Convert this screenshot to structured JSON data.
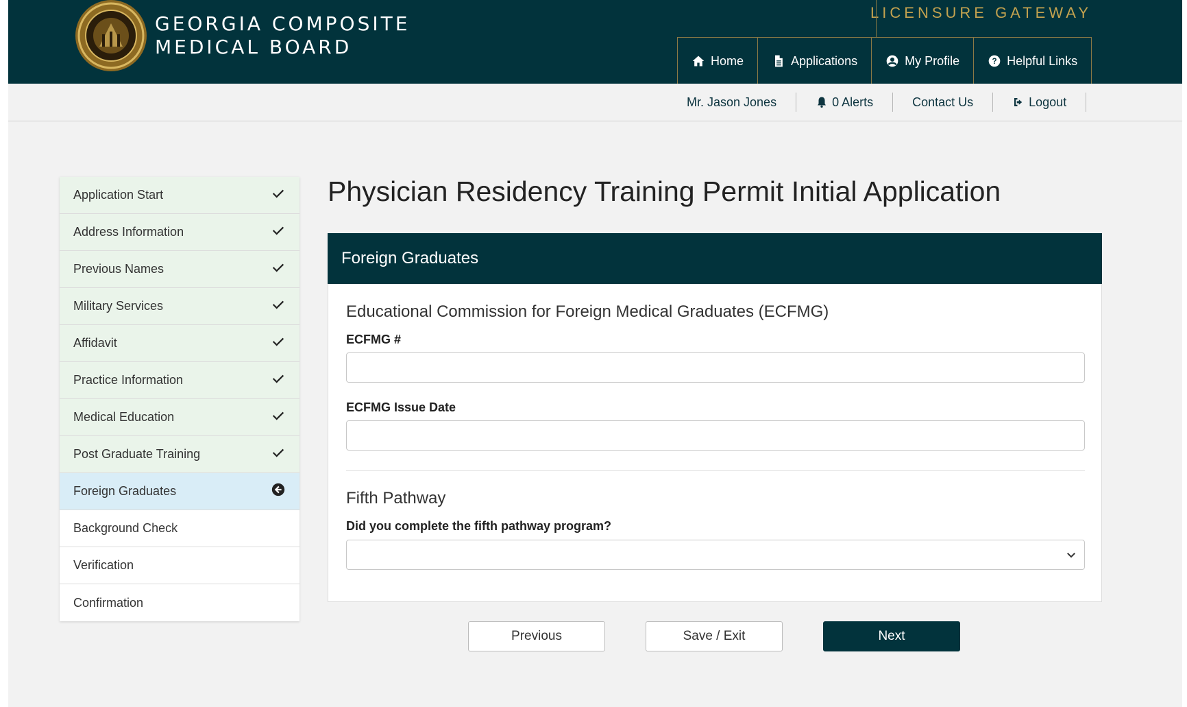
{
  "header": {
    "brand_line1": "GEORGIA COMPOSITE",
    "brand_line2": "MEDICAL BOARD",
    "gateway": "LICENSURE GATEWAY",
    "seal_icon": "georgia-composite-medical-board-seal",
    "nav": [
      {
        "label": "Home",
        "icon": "home-icon"
      },
      {
        "label": "Applications",
        "icon": "document-icon"
      },
      {
        "label": "My Profile",
        "icon": "user-circle-icon"
      },
      {
        "label": "Helpful Links",
        "icon": "question-circle-icon"
      }
    ]
  },
  "utility": {
    "user": "Mr. Jason Jones",
    "alerts": "0 Alerts",
    "contact": "Contact Us",
    "logout": "Logout"
  },
  "sidebar": {
    "items": [
      {
        "label": "Application Start",
        "state": "done"
      },
      {
        "label": "Address Information",
        "state": "done"
      },
      {
        "label": "Previous Names",
        "state": "done"
      },
      {
        "label": "Military Services",
        "state": "done"
      },
      {
        "label": "Affidavit",
        "state": "done"
      },
      {
        "label": "Practice Information",
        "state": "done"
      },
      {
        "label": "Medical Education",
        "state": "done"
      },
      {
        "label": "Post Graduate Training",
        "state": "done"
      },
      {
        "label": "Foreign Graduates",
        "state": "active"
      },
      {
        "label": "Background Check",
        "state": "todo"
      },
      {
        "label": "Verification",
        "state": "todo"
      },
      {
        "label": "Confirmation",
        "state": "todo"
      }
    ]
  },
  "main": {
    "title": "Physician Residency Training Permit Initial Application",
    "panel_title": "Foreign Graduates",
    "ecfmg_section": "Educational Commission for Foreign Medical Graduates (ECFMG)",
    "ecfmg_number_label": "ECFMG #",
    "ecfmg_number_value": "",
    "ecfmg_date_label": "ECFMG Issue Date",
    "ecfmg_date_value": "",
    "fifth_section": "Fifth Pathway",
    "fifth_question": "Did you complete the fifth pathway program?",
    "fifth_selected": ""
  },
  "buttons": {
    "previous": "Previous",
    "save": "Save / Exit",
    "next": "Next"
  },
  "colors": {
    "brand_dark": "#02333c",
    "gold": "#c3a24f",
    "completed_step": "#eaf4ea",
    "active_step": "#d9edf7"
  }
}
